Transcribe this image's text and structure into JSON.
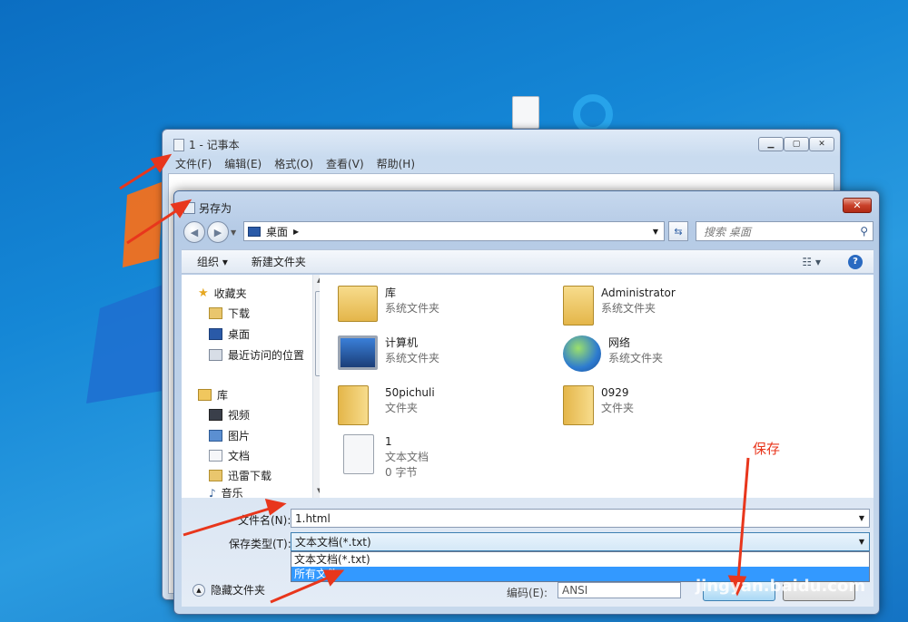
{
  "notepad": {
    "title": "1 - 记事本",
    "menu": [
      "文件(F)",
      "编辑(E)",
      "格式(O)",
      "查看(V)",
      "帮助(H)"
    ]
  },
  "dialog": {
    "title": "另存为",
    "address": "桌面",
    "search_placeholder": "搜索 桌面",
    "toolbar": {
      "organize": "组织",
      "new_folder": "新建文件夹"
    },
    "nav": {
      "favorites": "收藏夹",
      "downloads": "下载",
      "desktop": "桌面",
      "recent": "最近访问的位置",
      "libraries": "库",
      "videos": "视频",
      "pictures": "图片",
      "documents": "文档",
      "xunlei": "迅雷下载",
      "music": "音乐"
    },
    "files": [
      {
        "name": "库",
        "type": "系统文件夹"
      },
      {
        "name": "Administrator",
        "type": "系统文件夹"
      },
      {
        "name": "计算机",
        "type": "系统文件夹"
      },
      {
        "name": "网络",
        "type": "系统文件夹"
      },
      {
        "name": "50pichuli",
        "type": "文件夹"
      },
      {
        "name": "0929",
        "type": "文件夹"
      },
      {
        "name": "1",
        "type": "文本文档",
        "size": "0 字节"
      }
    ],
    "filename_label": "文件名(N):",
    "filename_value": "1.html",
    "savetype_label": "保存类型(T):",
    "savetype_value": "文本文档(*.txt)",
    "type_options": [
      "文本文档(*.txt)",
      "所有文件"
    ],
    "hide_folders": "隐藏文件夹",
    "encoding_label": "编码(E):",
    "encoding_value": "ANSI"
  },
  "annotation": "保存",
  "watermark": "jingyan.baidu.com",
  "colors": {
    "annotation": "#e8361c",
    "selection": "#3399ff"
  }
}
